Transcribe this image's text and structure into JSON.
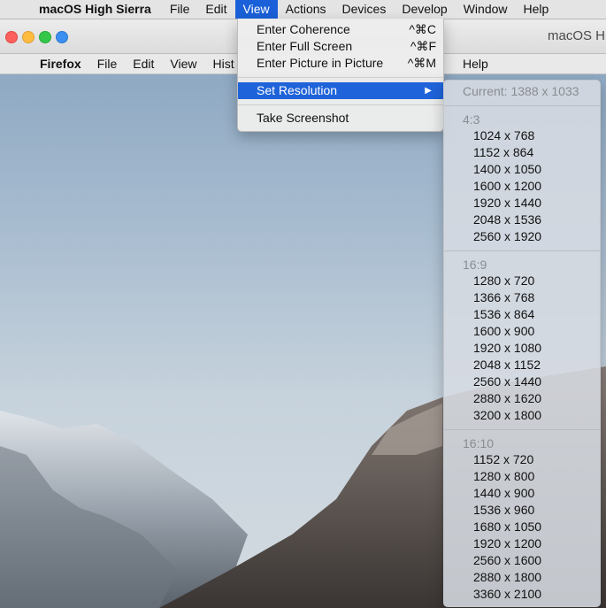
{
  "host_menubar": {
    "app_name": "macOS High Sierra",
    "items": [
      "File",
      "Edit",
      "View",
      "Actions",
      "Devices",
      "Develop",
      "Window",
      "Help"
    ]
  },
  "window": {
    "title": "macOS H"
  },
  "guest_menubar": {
    "app_name": "Firefox",
    "items": [
      "File",
      "Edit",
      "View",
      "Hist"
    ],
    "help": "Help"
  },
  "view_menu": {
    "items": [
      {
        "label": "Enter Coherence",
        "shortcut": "^⌘C"
      },
      {
        "label": "Enter Full Screen",
        "shortcut": "^⌘F"
      },
      {
        "label": "Enter Picture in Picture",
        "shortcut": "^⌘M"
      }
    ],
    "set_resolution": "Set Resolution",
    "take_screenshot": "Take Screenshot"
  },
  "resolution_menu": {
    "current": "Current: 1388 x 1033",
    "groups": [
      {
        "name": "4:3",
        "items": [
          "1024 x 768",
          "1152 x 864",
          "1400 x 1050",
          "1600 x 1200",
          "1920 x 1440",
          "2048 x 1536",
          "2560 x 1920"
        ]
      },
      {
        "name": "16:9",
        "items": [
          "1280 x 720",
          "1366 x 768",
          "1536 x 864",
          "1600 x 900",
          "1920 x 1080",
          "2048 x 1152",
          "2560 x 1440",
          "2880 x 1620",
          "3200 x 1800"
        ]
      },
      {
        "name": "16:10",
        "items": [
          "1152 x 720",
          "1280 x 800",
          "1440 x 900",
          "1536 x 960",
          "1680 x 1050",
          "1920 x 1200",
          "2560 x 1600",
          "2880 x 1800",
          "3360 x 2100"
        ]
      }
    ]
  },
  "icons": {
    "apple": "apple-logo-icon",
    "submenu_arrow": "submenu-arrow-icon"
  },
  "colors": {
    "highlight": "#1f63da",
    "close": "#fc605c",
    "minimize": "#fdbc40",
    "zoom": "#34c84a"
  }
}
